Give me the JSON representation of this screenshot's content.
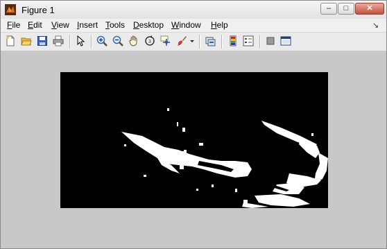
{
  "window": {
    "title": "Figure 1"
  },
  "title_controls": {
    "minimize_label": "–",
    "maximize_label": "□",
    "close_label": "✕"
  },
  "menubar": {
    "items": [
      {
        "key": "F",
        "rest": "ile"
      },
      {
        "key": "E",
        "rest": "dit"
      },
      {
        "key": "V",
        "rest": "iew"
      },
      {
        "key": "I",
        "rest": "nsert"
      },
      {
        "key": "T",
        "rest": "ools"
      },
      {
        "key": "D",
        "rest": "esktop"
      },
      {
        "key": "W",
        "rest": "indow"
      },
      {
        "key": "H",
        "rest": "elp"
      }
    ],
    "dock_glyph": "↘"
  },
  "toolbar": {
    "icons": [
      "new-figure-icon",
      "open-file-icon",
      "save-icon",
      "print-icon",
      "edit-plot-arrow-icon",
      "zoom-in-icon",
      "zoom-out-icon",
      "pan-hand-icon",
      "rotate-3d-icon",
      "data-cursor-icon",
      "brush-icon",
      "brush-dropdown-icon",
      "link-plot-icon",
      "insert-colorbar-icon",
      "insert-legend-icon",
      "hide-plot-tools-icon",
      "show-plot-tools-icon"
    ]
  },
  "colors": {
    "axes_background": "#000000",
    "figure_background": "#c8c8c8",
    "image_foreground": "#ffffff"
  }
}
